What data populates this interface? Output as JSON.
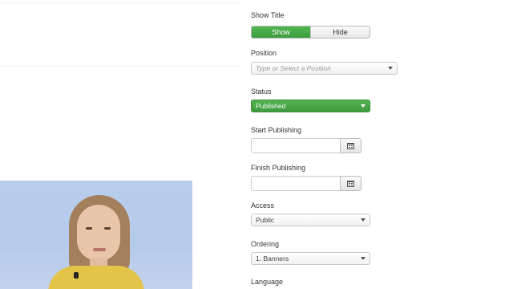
{
  "form": {
    "show_title": {
      "label": "Show Title",
      "options": [
        {
          "label": "Show",
          "active": true
        },
        {
          "label": "Hide",
          "active": false
        }
      ]
    },
    "position": {
      "label": "Position",
      "placeholder": "Type or Select a Position"
    },
    "status": {
      "label": "Status",
      "value": "Published",
      "color": "#46a546"
    },
    "start_publishing": {
      "label": "Start Publishing",
      "value": ""
    },
    "finish_publishing": {
      "label": "Finish Publishing",
      "value": ""
    },
    "access": {
      "label": "Access",
      "value": "Public"
    },
    "ordering": {
      "label": "Ordering",
      "value": "1. Banners"
    },
    "language": {
      "label": "Language"
    }
  },
  "icons": {
    "calendar": "calendar-icon",
    "dropdown": "chevron-down-icon"
  }
}
